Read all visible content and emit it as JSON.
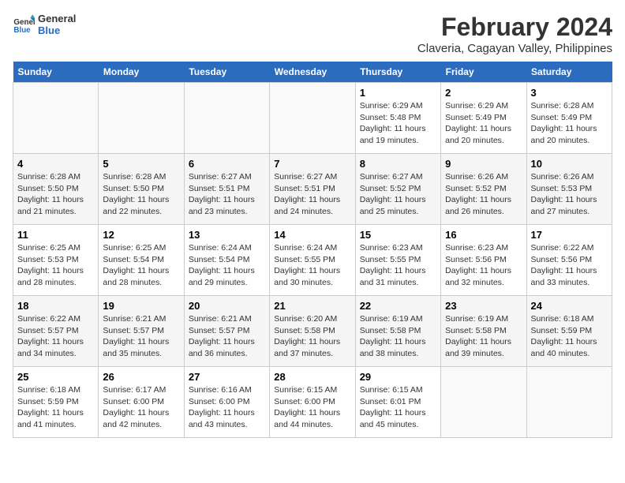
{
  "header": {
    "logo_line1": "General",
    "logo_line2": "Blue",
    "title": "February 2024",
    "subtitle": "Claveria, Cagayan Valley, Philippines"
  },
  "weekdays": [
    "Sunday",
    "Monday",
    "Tuesday",
    "Wednesday",
    "Thursday",
    "Friday",
    "Saturday"
  ],
  "weeks": [
    [
      {
        "day": "",
        "info": ""
      },
      {
        "day": "",
        "info": ""
      },
      {
        "day": "",
        "info": ""
      },
      {
        "day": "",
        "info": ""
      },
      {
        "day": "1",
        "info": "Sunrise: 6:29 AM\nSunset: 5:48 PM\nDaylight: 11 hours and 19 minutes."
      },
      {
        "day": "2",
        "info": "Sunrise: 6:29 AM\nSunset: 5:49 PM\nDaylight: 11 hours and 20 minutes."
      },
      {
        "day": "3",
        "info": "Sunrise: 6:28 AM\nSunset: 5:49 PM\nDaylight: 11 hours and 20 minutes."
      }
    ],
    [
      {
        "day": "4",
        "info": "Sunrise: 6:28 AM\nSunset: 5:50 PM\nDaylight: 11 hours and 21 minutes."
      },
      {
        "day": "5",
        "info": "Sunrise: 6:28 AM\nSunset: 5:50 PM\nDaylight: 11 hours and 22 minutes."
      },
      {
        "day": "6",
        "info": "Sunrise: 6:27 AM\nSunset: 5:51 PM\nDaylight: 11 hours and 23 minutes."
      },
      {
        "day": "7",
        "info": "Sunrise: 6:27 AM\nSunset: 5:51 PM\nDaylight: 11 hours and 24 minutes."
      },
      {
        "day": "8",
        "info": "Sunrise: 6:27 AM\nSunset: 5:52 PM\nDaylight: 11 hours and 25 minutes."
      },
      {
        "day": "9",
        "info": "Sunrise: 6:26 AM\nSunset: 5:52 PM\nDaylight: 11 hours and 26 minutes."
      },
      {
        "day": "10",
        "info": "Sunrise: 6:26 AM\nSunset: 5:53 PM\nDaylight: 11 hours and 27 minutes."
      }
    ],
    [
      {
        "day": "11",
        "info": "Sunrise: 6:25 AM\nSunset: 5:53 PM\nDaylight: 11 hours and 28 minutes."
      },
      {
        "day": "12",
        "info": "Sunrise: 6:25 AM\nSunset: 5:54 PM\nDaylight: 11 hours and 28 minutes."
      },
      {
        "day": "13",
        "info": "Sunrise: 6:24 AM\nSunset: 5:54 PM\nDaylight: 11 hours and 29 minutes."
      },
      {
        "day": "14",
        "info": "Sunrise: 6:24 AM\nSunset: 5:55 PM\nDaylight: 11 hours and 30 minutes."
      },
      {
        "day": "15",
        "info": "Sunrise: 6:23 AM\nSunset: 5:55 PM\nDaylight: 11 hours and 31 minutes."
      },
      {
        "day": "16",
        "info": "Sunrise: 6:23 AM\nSunset: 5:56 PM\nDaylight: 11 hours and 32 minutes."
      },
      {
        "day": "17",
        "info": "Sunrise: 6:22 AM\nSunset: 5:56 PM\nDaylight: 11 hours and 33 minutes."
      }
    ],
    [
      {
        "day": "18",
        "info": "Sunrise: 6:22 AM\nSunset: 5:57 PM\nDaylight: 11 hours and 34 minutes."
      },
      {
        "day": "19",
        "info": "Sunrise: 6:21 AM\nSunset: 5:57 PM\nDaylight: 11 hours and 35 minutes."
      },
      {
        "day": "20",
        "info": "Sunrise: 6:21 AM\nSunset: 5:57 PM\nDaylight: 11 hours and 36 minutes."
      },
      {
        "day": "21",
        "info": "Sunrise: 6:20 AM\nSunset: 5:58 PM\nDaylight: 11 hours and 37 minutes."
      },
      {
        "day": "22",
        "info": "Sunrise: 6:19 AM\nSunset: 5:58 PM\nDaylight: 11 hours and 38 minutes."
      },
      {
        "day": "23",
        "info": "Sunrise: 6:19 AM\nSunset: 5:58 PM\nDaylight: 11 hours and 39 minutes."
      },
      {
        "day": "24",
        "info": "Sunrise: 6:18 AM\nSunset: 5:59 PM\nDaylight: 11 hours and 40 minutes."
      }
    ],
    [
      {
        "day": "25",
        "info": "Sunrise: 6:18 AM\nSunset: 5:59 PM\nDaylight: 11 hours and 41 minutes."
      },
      {
        "day": "26",
        "info": "Sunrise: 6:17 AM\nSunset: 6:00 PM\nDaylight: 11 hours and 42 minutes."
      },
      {
        "day": "27",
        "info": "Sunrise: 6:16 AM\nSunset: 6:00 PM\nDaylight: 11 hours and 43 minutes."
      },
      {
        "day": "28",
        "info": "Sunrise: 6:15 AM\nSunset: 6:00 PM\nDaylight: 11 hours and 44 minutes."
      },
      {
        "day": "29",
        "info": "Sunrise: 6:15 AM\nSunset: 6:01 PM\nDaylight: 11 hours and 45 minutes."
      },
      {
        "day": "",
        "info": ""
      },
      {
        "day": "",
        "info": ""
      }
    ]
  ]
}
